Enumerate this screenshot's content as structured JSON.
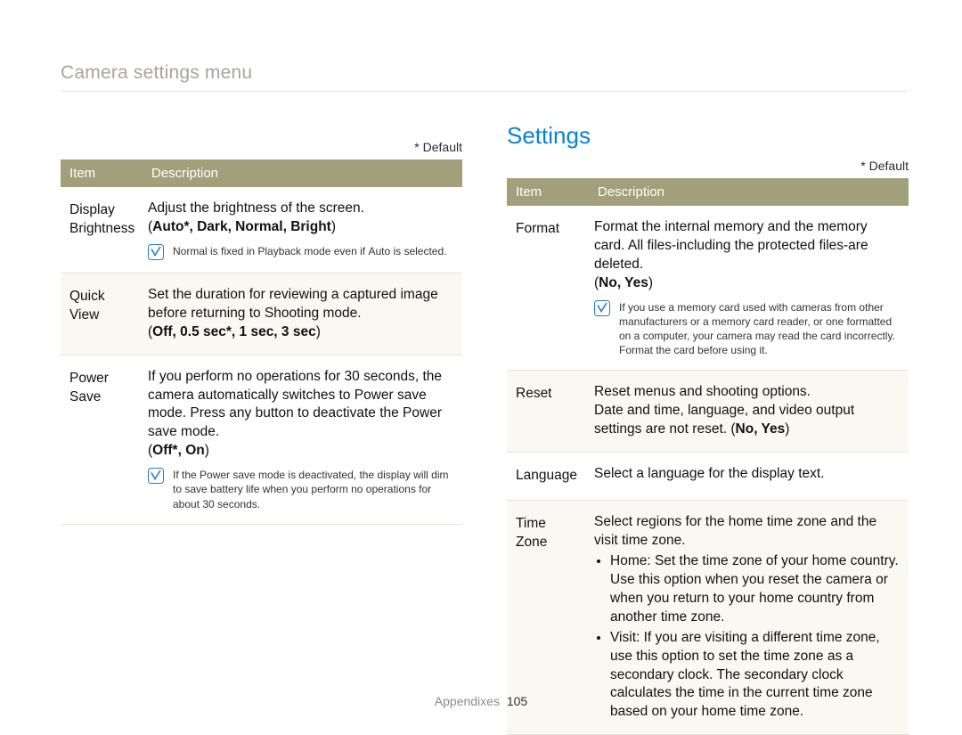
{
  "breadcrumb": "Camera settings menu",
  "section_title": "Settings",
  "default_note": "* Default",
  "col_headers": {
    "item": "Item",
    "desc": "Description"
  },
  "left": {
    "rows": [
      {
        "item": "Display Brightness",
        "body": "Adjust the brightness of the screen.",
        "options_prefix": "(",
        "options": "Auto*, Dark, Normal, Bright",
        "options_suffix": ")",
        "note": {
          "pre": "",
          "b1": "Normal",
          "mid1": " is fixed in Playback mode even if ",
          "b2": "Auto",
          "post": " is selected."
        }
      },
      {
        "item": "Quick View",
        "body": "Set the duration for reviewing a captured image before returning to Shooting mode.",
        "options_prefix": "(",
        "options": "Off, 0.5 sec*, 1 sec, 3 sec",
        "options_suffix": ")"
      },
      {
        "item": "Power Save",
        "body": "If you perform no operations for 30 seconds, the camera automatically switches to Power save mode. Press any button to deactivate the Power save mode.",
        "options_prefix": "(",
        "options": "Off*, On",
        "options_suffix": ")",
        "note_plain": "If the Power save mode is deactivated, the display will dim to save battery life when you perform no operations for about 30 seconds."
      }
    ]
  },
  "right": {
    "rows": [
      {
        "item": "Format",
        "body": "Format the internal memory and the memory card. All files-including the protected files-are deleted.",
        "options_prefix": "(",
        "options": "No, Yes",
        "options_suffix": ")",
        "note_plain": "If you use a memory card used with cameras from other manufacturers or a memory card reader, or one formatted on a computer, your camera may read the card incorrectly. Format the card before using it."
      },
      {
        "item": "Reset",
        "body_pre": "Reset menus and shooting options.\nDate and time, language, and video output settings are not reset. (",
        "options": "No, Yes",
        "body_post": ")"
      },
      {
        "item": "Language",
        "body": "Select a language for the display text."
      },
      {
        "item": "Time Zone",
        "intro": "Select regions for the home time zone and the visit time zone.",
        "bullets": [
          {
            "label": "Home",
            "text": ": Set the time zone of your home country. Use this option when you reset the camera or when you return to your home country from another time zone."
          },
          {
            "label": "Visit",
            "text": ": If you are visiting a different time zone, use this option to set the time zone as a secondary clock. The secondary clock calculates the time in the current time zone based on your home time zone."
          }
        ]
      }
    ]
  },
  "footer": {
    "section": "Appendixes",
    "page": "105"
  }
}
